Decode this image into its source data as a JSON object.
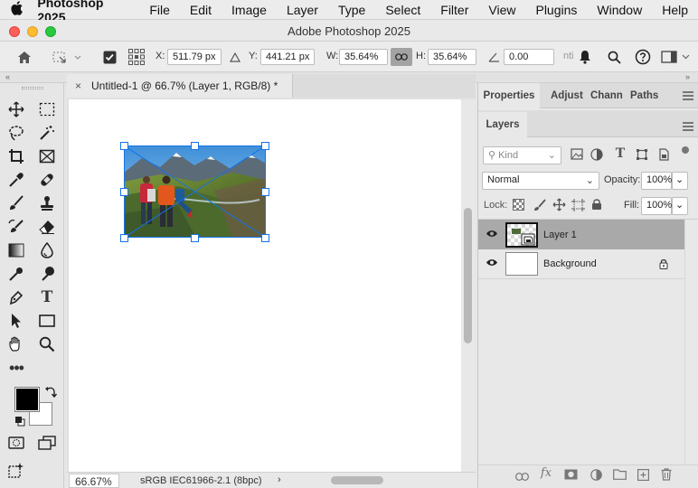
{
  "menubar": {
    "app_name": "Photoshop 2025",
    "items": [
      "File",
      "Edit",
      "Image",
      "Layer",
      "Type",
      "Select",
      "Filter",
      "View",
      "Plugins",
      "Window",
      "Help"
    ]
  },
  "window": {
    "title": "Adobe Photoshop 2025"
  },
  "options": {
    "x_label": "X:",
    "x_value": "511.79 px",
    "y_label": "Y:",
    "y_value": "441.21 px",
    "w_label": "W:",
    "w_value": "35.64%",
    "h_label": "H:",
    "h_value": "35.64%",
    "angle_value": "0.00",
    "anti_label": "nti"
  },
  "document": {
    "tab_title": "Untitled-1 @ 66.7% (Layer 1, RGB/8) *",
    "zoom": "66.67%",
    "color_profile": "sRGB IEC61966-2.1 (8bpc)"
  },
  "panels": {
    "top_tabs": [
      "Properties",
      "Adjustments",
      "Channels",
      "Paths"
    ],
    "layers_tab": "Layers",
    "kind_placeholder": "Kind",
    "blend_mode": "Normal",
    "opacity_label": "Opacity:",
    "opacity_value": "100%",
    "lock_label": "Lock:",
    "fill_label": "Fill:",
    "fill_value": "100%",
    "layers": [
      {
        "name": "Layer 1",
        "selected": true
      },
      {
        "name": "Background",
        "selected": false,
        "locked": true
      }
    ]
  },
  "colors": {
    "accent": "#1473e6",
    "selected_layer": "#a9a9a9"
  }
}
